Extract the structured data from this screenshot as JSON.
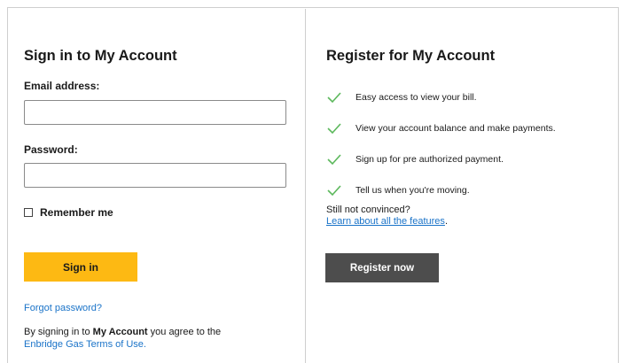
{
  "signin": {
    "heading": "Sign in to My Account",
    "email_label": "Email address:",
    "email_value": "",
    "password_label": "Password:",
    "password_value": "",
    "remember_label": "Remember me",
    "signin_button": "Sign in",
    "forgot_link": "Forgot password?",
    "agree_prefix": "By signing in to ",
    "agree_bold": "My Account",
    "agree_suffix": " you agree to the",
    "terms_link": "Enbridge Gas Terms of Use."
  },
  "register": {
    "heading": "Register for My Account",
    "features": [
      "Easy access to view your bill.",
      "View your account balance and make payments.",
      "Sign up for pre authorized payment.",
      "Tell us when you're moving."
    ],
    "still_text": "Still not convinced?",
    "learn_link": "Learn about all the features",
    "learn_end": ".",
    "register_button": "Register now"
  },
  "colors": {
    "signin_button": "#fdb913",
    "register_button": "#4d4d4d",
    "link": "#1a73c8",
    "check": "#5cb85c"
  },
  "icons": {
    "feature_check": "checkmark-icon"
  }
}
